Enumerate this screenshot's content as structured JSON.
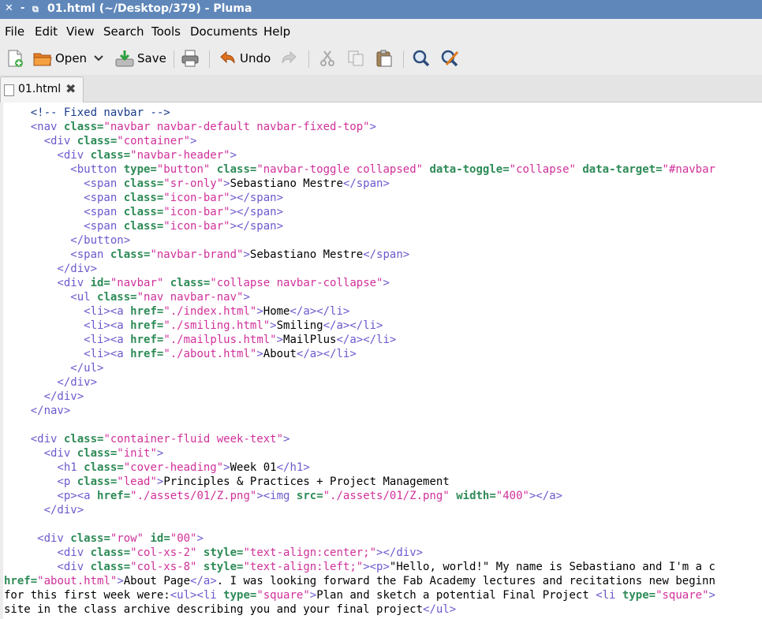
{
  "window": {
    "title": "01.html (~/Desktop/379) - Pluma",
    "close_glyph": "✕",
    "minimize_glyph": "-",
    "restore_glyph": "⧉"
  },
  "menu": {
    "items": [
      "File",
      "Edit",
      "View",
      "Search",
      "Tools",
      "Documents",
      "Help"
    ]
  },
  "toolbar": {
    "open_label": "Open",
    "save_label": "Save",
    "undo_label": "Undo"
  },
  "tabs": [
    {
      "label": "01.html",
      "close_glyph": "✖"
    }
  ],
  "colors": {
    "tag": "#6a5acd",
    "attribute": "#2e8b57",
    "value": "#d0309a",
    "comment": "#1a3c8e",
    "titlebar": "#5f87ba"
  },
  "editor": {
    "lines": [
      [
        [
          "cmt",
          "    <!-- Fixed navbar -->"
        ]
      ],
      [
        [
          "tag",
          "    <nav "
        ],
        [
          "attr",
          "class="
        ],
        [
          "val",
          "\"navbar navbar-default navbar-fixed-top\""
        ],
        [
          "tag",
          ">"
        ]
      ],
      [
        [
          "tag",
          "      <div "
        ],
        [
          "attr",
          "class="
        ],
        [
          "val",
          "\"container\""
        ],
        [
          "tag",
          ">"
        ]
      ],
      [
        [
          "tag",
          "        <div "
        ],
        [
          "attr",
          "class="
        ],
        [
          "val",
          "\"navbar-header\""
        ],
        [
          "tag",
          ">"
        ]
      ],
      [
        [
          "tag",
          "          <button "
        ],
        [
          "attr",
          "type="
        ],
        [
          "val",
          "\"button\""
        ],
        [
          "tag",
          " "
        ],
        [
          "attr",
          "class="
        ],
        [
          "val",
          "\"navbar-toggle collapsed\""
        ],
        [
          "tag",
          " "
        ],
        [
          "attr",
          "data-toggle="
        ],
        [
          "val",
          "\"collapse\""
        ],
        [
          "tag",
          " "
        ],
        [
          "attr",
          "data-target="
        ],
        [
          "val",
          "\"#navbar"
        ]
      ],
      [
        [
          "tag",
          "            <span "
        ],
        [
          "attr",
          "class="
        ],
        [
          "val",
          "\"sr-only\""
        ],
        [
          "tag",
          ">"
        ],
        [
          "txt",
          "Sebastiano Mestre"
        ],
        [
          "tag",
          "</span>"
        ]
      ],
      [
        [
          "tag",
          "            <span "
        ],
        [
          "attr",
          "class="
        ],
        [
          "val",
          "\"icon-bar\""
        ],
        [
          "tag",
          "></span>"
        ]
      ],
      [
        [
          "tag",
          "            <span "
        ],
        [
          "attr",
          "class="
        ],
        [
          "val",
          "\"icon-bar\""
        ],
        [
          "tag",
          "></span>"
        ]
      ],
      [
        [
          "tag",
          "            <span "
        ],
        [
          "attr",
          "class="
        ],
        [
          "val",
          "\"icon-bar\""
        ],
        [
          "tag",
          "></span>"
        ]
      ],
      [
        [
          "tag",
          "          </button>"
        ]
      ],
      [
        [
          "tag",
          "          <span "
        ],
        [
          "attr",
          "class="
        ],
        [
          "val",
          "\"navbar-brand\""
        ],
        [
          "tag",
          ">"
        ],
        [
          "txt",
          "Sebastiano Mestre"
        ],
        [
          "tag",
          "</span>"
        ]
      ],
      [
        [
          "tag",
          "        </div>"
        ]
      ],
      [
        [
          "tag",
          "        <div "
        ],
        [
          "attr",
          "id="
        ],
        [
          "val",
          "\"navbar\""
        ],
        [
          "tag",
          " "
        ],
        [
          "attr",
          "class="
        ],
        [
          "val",
          "\"collapse navbar-collapse\""
        ],
        [
          "tag",
          ">"
        ]
      ],
      [
        [
          "tag",
          "          <ul "
        ],
        [
          "attr",
          "class="
        ],
        [
          "val",
          "\"nav navbar-nav\""
        ],
        [
          "tag",
          ">"
        ]
      ],
      [
        [
          "tag",
          "            <li><a "
        ],
        [
          "attr",
          "href="
        ],
        [
          "val",
          "\"./index.html\""
        ],
        [
          "tag",
          ">"
        ],
        [
          "txt",
          "Home"
        ],
        [
          "tag",
          "</a></li>"
        ]
      ],
      [
        [
          "tag",
          "            <li><a "
        ],
        [
          "attr",
          "href="
        ],
        [
          "val",
          "\"./smiling.html\""
        ],
        [
          "tag",
          ">"
        ],
        [
          "txt",
          "Smiling"
        ],
        [
          "tag",
          "</a></li>"
        ]
      ],
      [
        [
          "tag",
          "            <li><a "
        ],
        [
          "attr",
          "href="
        ],
        [
          "val",
          "\"./mailplus.html\""
        ],
        [
          "tag",
          ">"
        ],
        [
          "txt",
          "MailPlus"
        ],
        [
          "tag",
          "</a></li>"
        ]
      ],
      [
        [
          "tag",
          "            <li><a "
        ],
        [
          "attr",
          "href="
        ],
        [
          "val",
          "\"./about.html\""
        ],
        [
          "tag",
          ">"
        ],
        [
          "txt",
          "About"
        ],
        [
          "tag",
          "</a></li>"
        ]
      ],
      [
        [
          "tag",
          "          </ul>"
        ]
      ],
      [
        [
          "tag",
          "        </div>"
        ]
      ],
      [
        [
          "tag",
          "      </div>"
        ]
      ],
      [
        [
          "tag",
          "    </nav>"
        ]
      ],
      [
        [
          "txt",
          ""
        ]
      ],
      [
        [
          "tag",
          "    <div "
        ],
        [
          "attr",
          "class="
        ],
        [
          "val",
          "\"container-fluid week-text\""
        ],
        [
          "tag",
          ">"
        ]
      ],
      [
        [
          "tag",
          "      <div "
        ],
        [
          "attr",
          "class="
        ],
        [
          "val",
          "\"init\""
        ],
        [
          "tag",
          ">"
        ]
      ],
      [
        [
          "tag",
          "        <h1 "
        ],
        [
          "attr",
          "class="
        ],
        [
          "val",
          "\"cover-heading\""
        ],
        [
          "tag",
          ">"
        ],
        [
          "txt",
          "Week 01"
        ],
        [
          "tag",
          "</h1>"
        ]
      ],
      [
        [
          "tag",
          "        <p "
        ],
        [
          "attr",
          "class="
        ],
        [
          "val",
          "\"lead\""
        ],
        [
          "tag",
          ">"
        ],
        [
          "txt",
          "Principles & Practices + Project Management"
        ]
      ],
      [
        [
          "tag",
          "        <p><a "
        ],
        [
          "attr",
          "href="
        ],
        [
          "val",
          "\"./assets/01/Z.png\""
        ],
        [
          "tag",
          "><img "
        ],
        [
          "attr",
          "src="
        ],
        [
          "val",
          "\"./assets/01/Z.png\""
        ],
        [
          "tag",
          " "
        ],
        [
          "attr",
          "width="
        ],
        [
          "val",
          "\"400\""
        ],
        [
          "tag",
          "></a>"
        ]
      ],
      [
        [
          "tag",
          "      </div>"
        ]
      ],
      [
        [
          "txt",
          ""
        ]
      ],
      [
        [
          "tag",
          "     <div "
        ],
        [
          "attr",
          "class="
        ],
        [
          "val",
          "\"row\""
        ],
        [
          "tag",
          " "
        ],
        [
          "attr",
          "id="
        ],
        [
          "val",
          "\"00\""
        ],
        [
          "tag",
          ">"
        ]
      ],
      [
        [
          "tag",
          "        <div "
        ],
        [
          "attr",
          "class="
        ],
        [
          "val",
          "\"col-xs-2\""
        ],
        [
          "tag",
          " "
        ],
        [
          "attr",
          "style="
        ],
        [
          "val",
          "\"text-align:center;\""
        ],
        [
          "tag",
          "></div>"
        ]
      ],
      [
        [
          "tag",
          "        <div "
        ],
        [
          "attr",
          "class="
        ],
        [
          "val",
          "\"col-xs-8\""
        ],
        [
          "tag",
          " "
        ],
        [
          "attr",
          "style="
        ],
        [
          "val",
          "\"text-align:left;\""
        ],
        [
          "tag",
          "><p>"
        ],
        [
          "txt",
          "\"Hello, world!\" My name is Sebastiano and I'm a c"
        ]
      ],
      [
        [
          "attr",
          "href="
        ],
        [
          "val",
          "\"about.html\""
        ],
        [
          "tag",
          ">"
        ],
        [
          "txt",
          "About Page"
        ],
        [
          "tag",
          "</a>"
        ],
        [
          "txt",
          ". I was looking forward the Fab Academy lectures and recitations new beginn"
        ]
      ],
      [
        [
          "txt",
          "for this first week were:"
        ],
        [
          "tag",
          "<ul><li "
        ],
        [
          "attr",
          "type="
        ],
        [
          "val",
          "\"square\""
        ],
        [
          "tag",
          ">"
        ],
        [
          "txt",
          "Plan and sketch a potential Final Project "
        ],
        [
          "tag",
          "<li "
        ],
        [
          "attr",
          "type="
        ],
        [
          "val",
          "\"square\""
        ],
        [
          "tag",
          ">"
        ]
      ],
      [
        [
          "txt",
          "site in the class archive describing you and your final project"
        ],
        [
          "tag",
          "</ul>"
        ]
      ]
    ]
  }
}
